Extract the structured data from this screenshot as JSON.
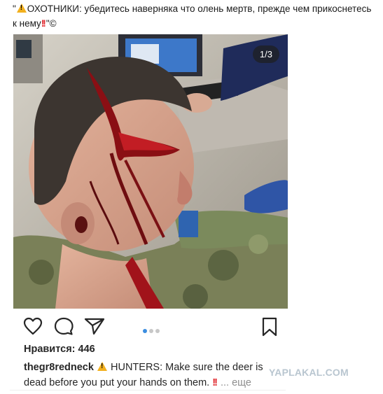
{
  "caption": {
    "quote_open": "\"",
    "text": "ОХОТНИКИ: убедитесь наверняка что олень мертв, прежде чем прикоснетесь к нему",
    "quote_close": "\"©",
    "bangs": "!!"
  },
  "post": {
    "photo_counter": "1/3",
    "carousel": {
      "total": 3,
      "active": 1
    },
    "likes": "Нравится: 446",
    "username": "thegr8redneck",
    "description": "HUNTERS: Make sure the deer is dead before you put your hands on them.",
    "bangs": "!!",
    "more": "... еще"
  },
  "watermark": "YAPLAKAL.COM",
  "icons": {
    "warning": "warning-icon",
    "like": "heart-icon",
    "comment": "comment-icon",
    "share": "share-icon",
    "save": "bookmark-icon"
  },
  "colors": {
    "accent_dot": "#3b8de0",
    "warning": "#f2b01e",
    "bang": "#e0242a"
  }
}
